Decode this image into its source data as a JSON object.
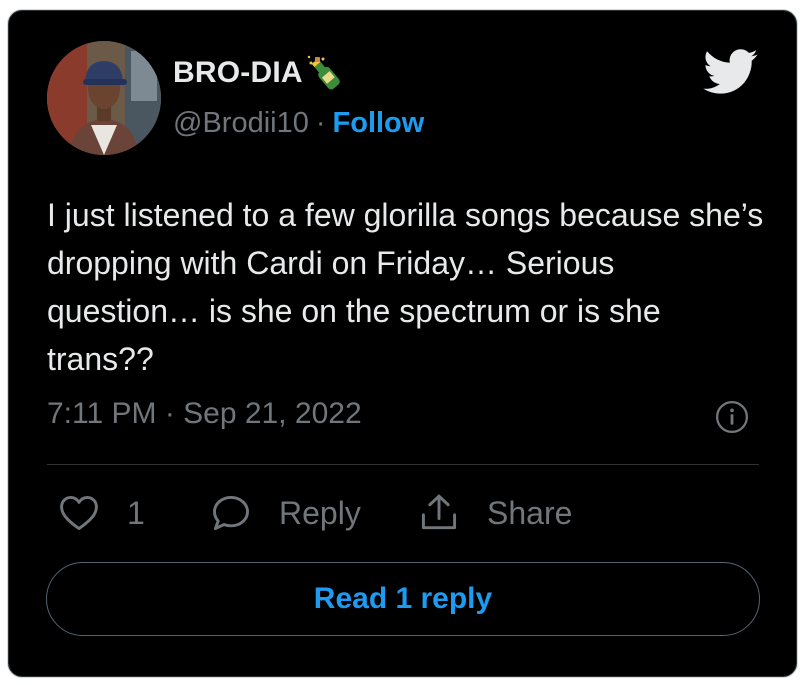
{
  "user": {
    "display_name": "BRO-DIA",
    "name_emoji": "bottle-with-popping-cork-icon",
    "handle": "@Brodii10",
    "separator": "·",
    "follow_label": "Follow"
  },
  "tweet": {
    "text": "I just listened to a few glorilla songs because she’s dropping with Cardi on Friday… Serious question… is she on the spectrum or is she trans??",
    "timestamp": "7:11 PM · Sep 21, 2022"
  },
  "actions": {
    "like_count": "1",
    "reply_label": "Reply",
    "share_label": "Share"
  },
  "read_replies_label": "Read 1 reply",
  "colors": {
    "background": "#000000",
    "text_primary": "#e7e9ea",
    "text_secondary": "#71767b",
    "accent": "#1d9bf0"
  }
}
